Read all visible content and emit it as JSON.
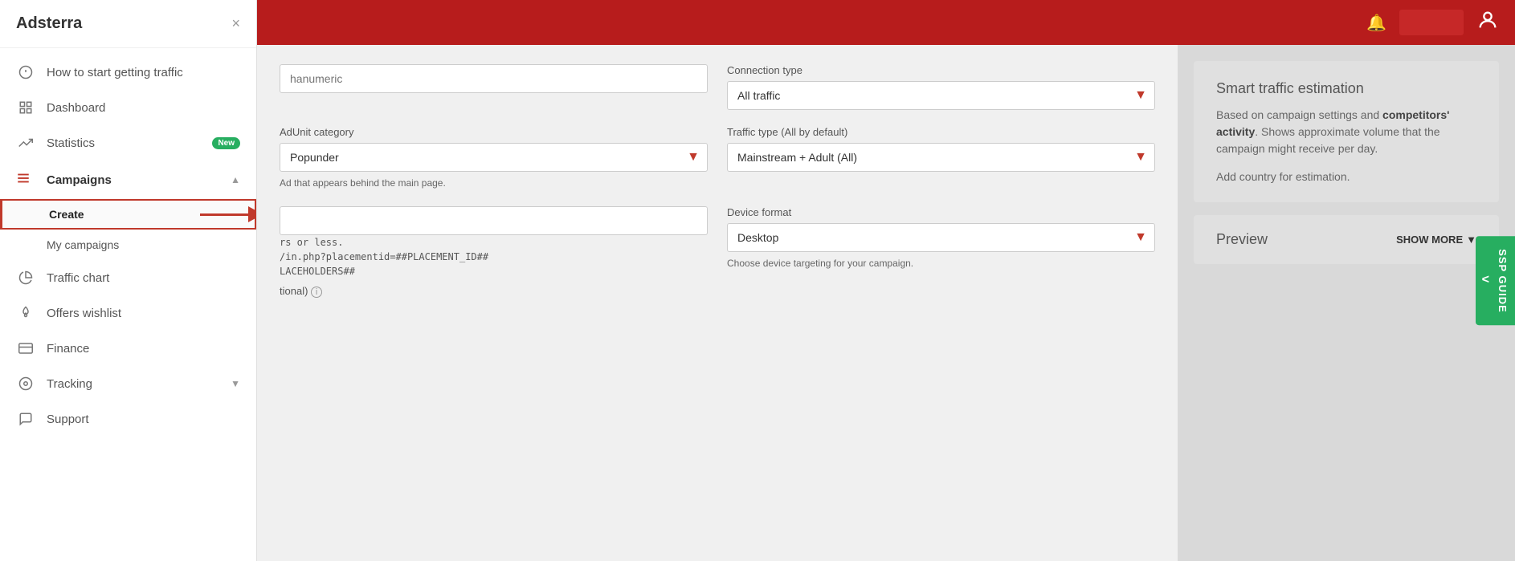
{
  "app": {
    "logo": "Adsterra",
    "close_label": "×"
  },
  "sidebar": {
    "items": [
      {
        "id": "how-to-start",
        "label": "How to start getting traffic",
        "icon": "alert-circle",
        "badge": null,
        "active": false
      },
      {
        "id": "dashboard",
        "label": "Dashboard",
        "icon": "grid",
        "badge": null,
        "active": false
      },
      {
        "id": "statistics",
        "label": "Statistics",
        "icon": "trending-up",
        "badge": "New",
        "active": false
      }
    ],
    "campaigns_section": {
      "label": "Campaigns",
      "icon": "list",
      "expanded": true,
      "sub_items": [
        {
          "id": "create",
          "label": "Create",
          "active": true
        },
        {
          "id": "my-campaigns",
          "label": "My campaigns",
          "active": false
        }
      ]
    },
    "items2": [
      {
        "id": "traffic-chart",
        "label": "Traffic chart",
        "icon": "pie-chart",
        "active": false
      },
      {
        "id": "offers-wishlist",
        "label": "Offers wishlist",
        "icon": "flame",
        "active": false
      },
      {
        "id": "finance",
        "label": "Finance",
        "icon": "credit-card",
        "active": false
      },
      {
        "id": "tracking",
        "label": "Tracking",
        "icon": "circle-dashed",
        "chevron": "down",
        "active": false
      },
      {
        "id": "support",
        "label": "Support",
        "icon": "message-square",
        "active": false
      }
    ]
  },
  "topbar": {
    "bell_icon": "🔔",
    "user_icon": "👤",
    "button_label": ""
  },
  "form": {
    "input_placeholder": "hanumeric",
    "connection_type": {
      "label": "Connection type",
      "value": "All traffic"
    },
    "adunit_category": {
      "label": "AdUnit category",
      "value": "Popunder",
      "hint": "Ad that appears behind the main page."
    },
    "traffic_type": {
      "label": "Traffic type (All by default)",
      "value": "Mainstream + Adult (All)"
    },
    "device_format": {
      "label": "Device format",
      "value": "Desktop",
      "hint": "Choose device targeting for your campaign."
    },
    "url_label": "rs or less.",
    "url_value": "/in.php?placementid=##PLACEMENT_ID##",
    "url_value2": "LACEHOLDERS##",
    "optional_label": "tional)"
  },
  "estimation": {
    "title": "Smart traffic estimation",
    "description_plain": "Based on campaign settings and ",
    "description_bold": "competitors' activity",
    "description_end": ". Shows approximate volume that the campaign might receive per day.",
    "note": "Add country for estimation."
  },
  "preview": {
    "title": "Preview",
    "show_more": "SHOW MORE"
  },
  "ssp_guide": {
    "label": "SSP GUIDE",
    "chevron": "<"
  }
}
